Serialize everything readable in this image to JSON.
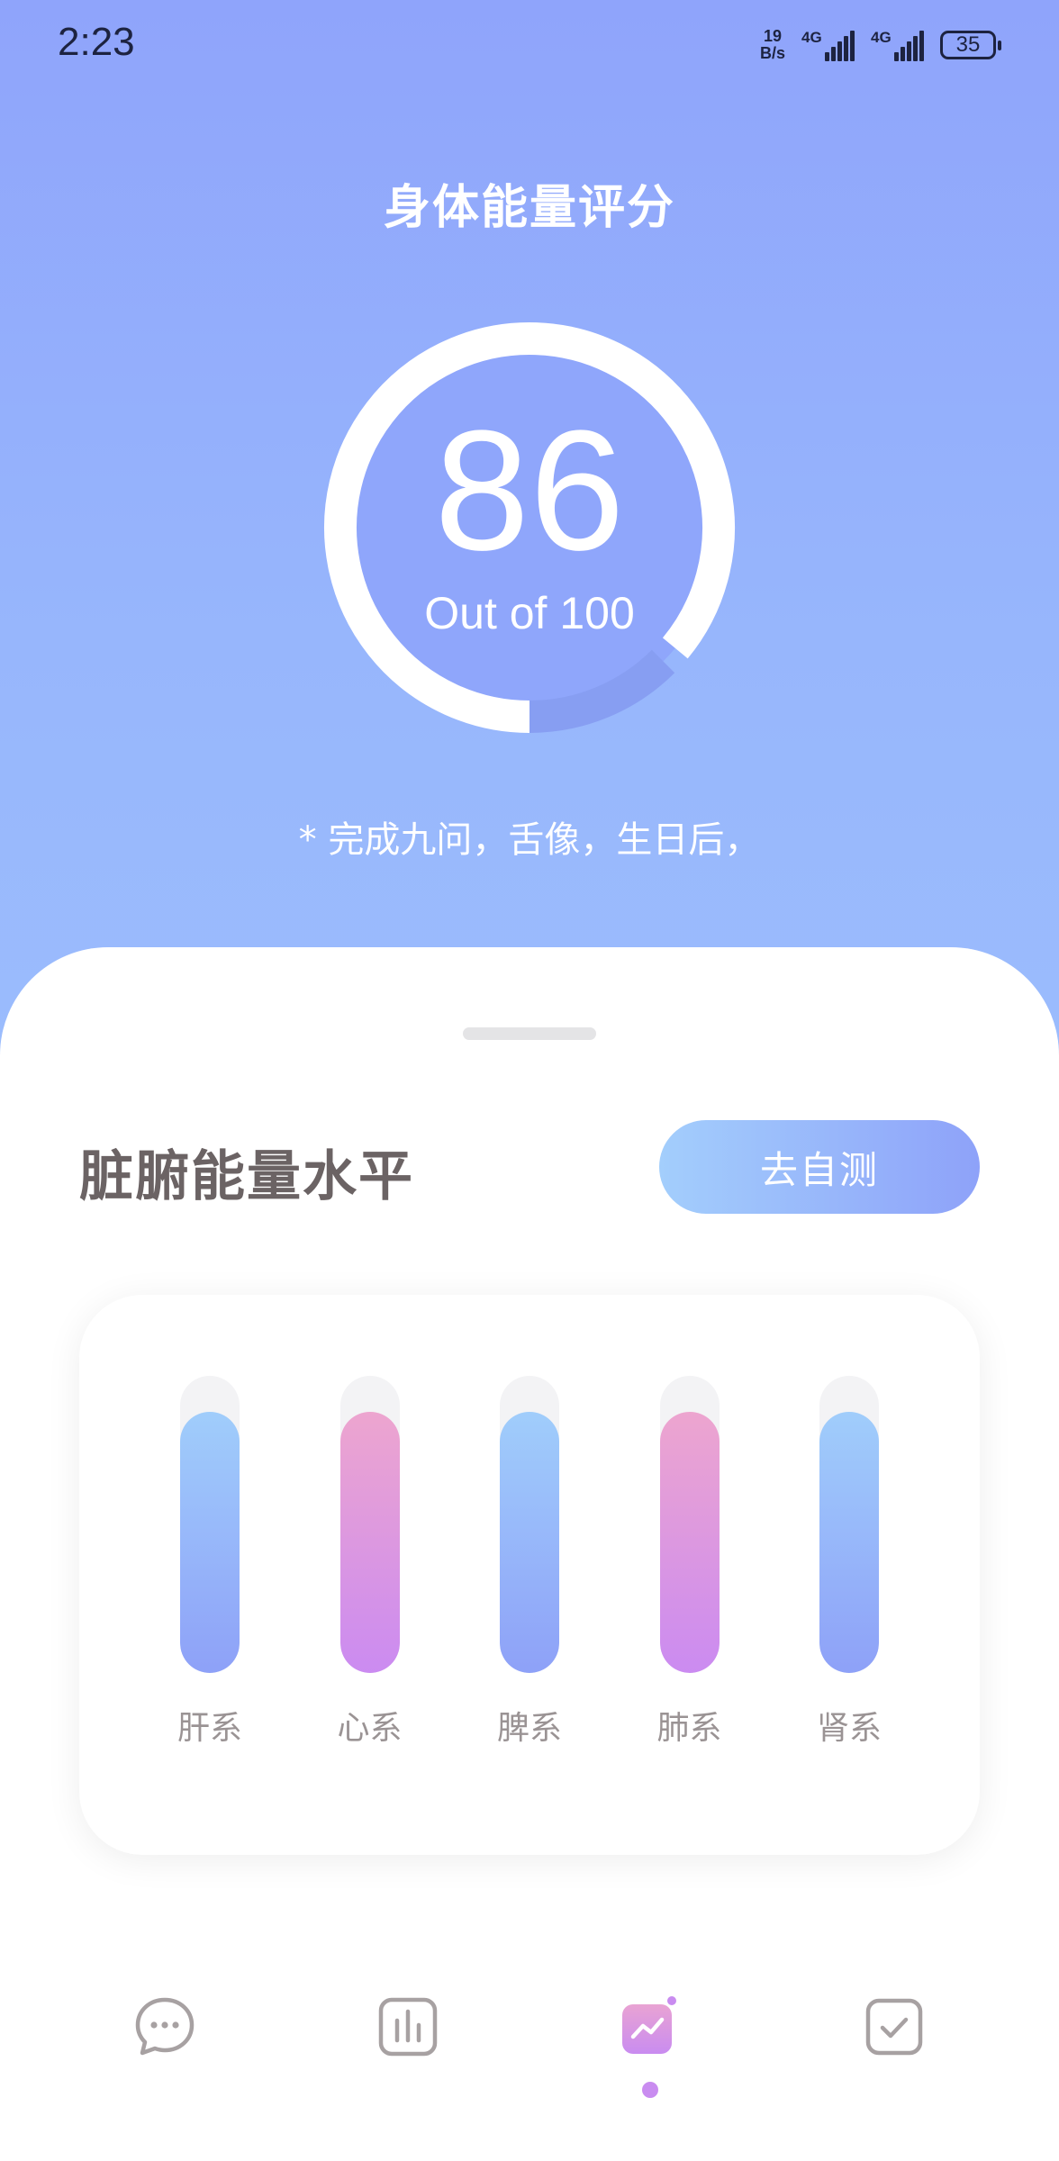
{
  "status_bar": {
    "time": "2:23",
    "net_speed_value": "19",
    "net_speed_unit": "B/s",
    "sim1_label": "4G",
    "sim2_label": "4G",
    "battery": "35"
  },
  "score": {
    "title": "身体能量评分",
    "value": "86",
    "subtitle": "Out of 100",
    "progress": 0.86,
    "note": "* 完成九问，舌像，生日后，"
  },
  "section": {
    "title": "脏腑能量水平",
    "self_test_button": "去自测"
  },
  "organs": [
    {
      "label": "肝系",
      "level": 0.88,
      "color": "blue"
    },
    {
      "label": "心系",
      "level": 0.88,
      "color": "pink"
    },
    {
      "label": "脾系",
      "level": 0.88,
      "color": "blue"
    },
    {
      "label": "肺系",
      "level": 0.88,
      "color": "pink"
    },
    {
      "label": "肾系",
      "level": 0.88,
      "color": "blue"
    }
  ],
  "tabs": [
    {
      "icon": "chat-bubble-icon",
      "active": false
    },
    {
      "icon": "bar-chart-icon",
      "active": false
    },
    {
      "icon": "trend-chart-icon",
      "active": true
    },
    {
      "icon": "checkbox-icon",
      "active": false
    }
  ],
  "colors": {
    "header_gradient_top": "#8fa4fb",
    "header_gradient_bottom": "#9bbcfd",
    "accent_blue": "#8ea1f8",
    "accent_pink": "#cb8bf1",
    "active_tab": "#c98cf0"
  }
}
